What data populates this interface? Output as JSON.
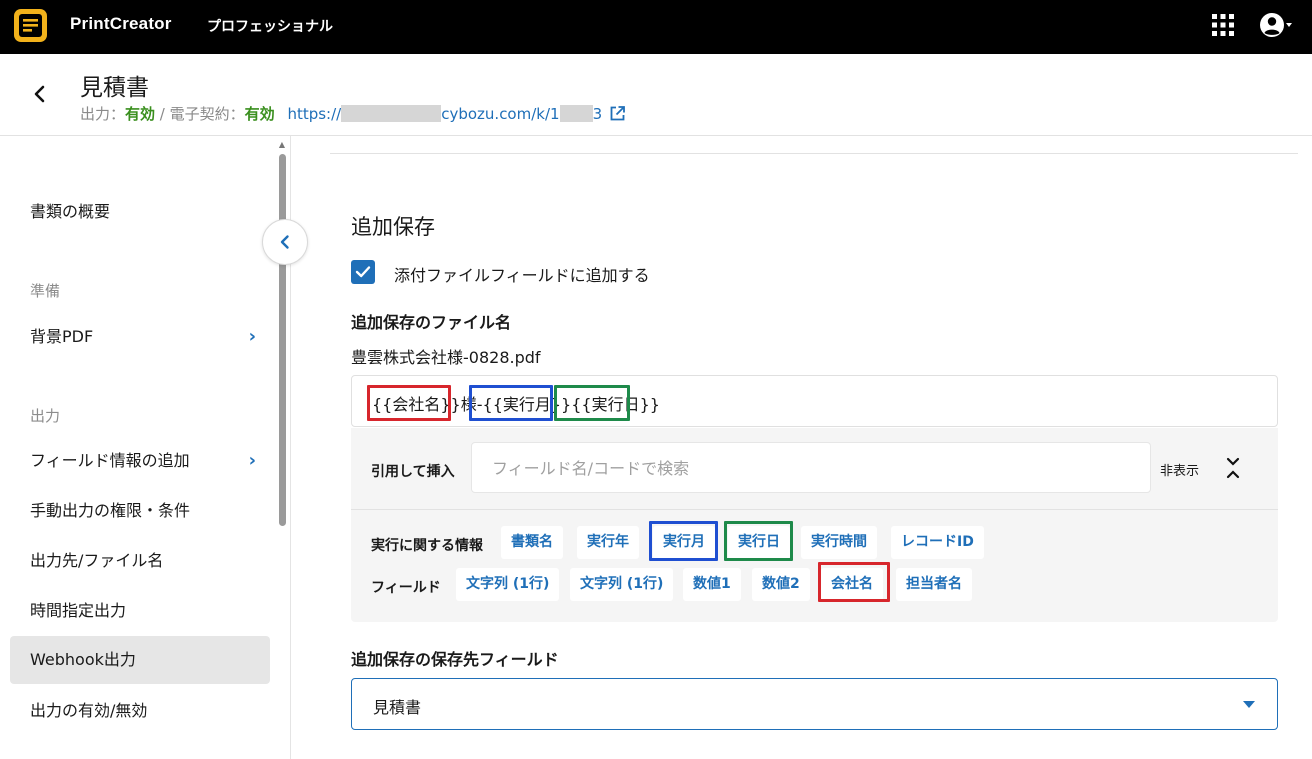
{
  "app": {
    "name": "PrintCreator",
    "edition": "プロフェッショナル",
    "colors": {
      "topbar": "#000000",
      "accent": "#1f6fb8",
      "ok": "#3a8f1e"
    }
  },
  "header": {
    "title": "見積書",
    "output_label": "出力：",
    "output_status": "有効",
    "separator": " / ",
    "contract_label": "電子契約：",
    "contract_status": "有効",
    "url_prefix": "https://",
    "url_middle": "cybozu.com/k/1",
    "url_suffix": "3"
  },
  "sidebar": {
    "overview": "書類の概要",
    "section_prep": "準備",
    "background_pdf": "背景PDF",
    "section_output": "出力",
    "items": [
      {
        "label": "フィールド情報の追加",
        "has_chevron": true
      },
      {
        "label": "手動出力の権限・条件"
      },
      {
        "label": "出力先/ファイル名"
      },
      {
        "label": "時間指定出力"
      },
      {
        "label": "Webhook出力",
        "active": true
      },
      {
        "label": "出力の有効/無効"
      }
    ],
    "chevron": "›"
  },
  "main": {
    "section_title": "追加保存",
    "checkbox_label": "添付ファイルフィールドに追加する",
    "checkbox_checked": true,
    "filename_label": "追加保存のファイル名",
    "filename_preview": "豊雲株式会社様-0828.pdf",
    "template": {
      "part1": "{{会社名}}",
      "part2": "様-",
      "part3": "{{実行月}}",
      "part4": "{{実行日}}"
    },
    "picker": {
      "insert_label": "引用して挿入",
      "search_placeholder": "フィールド名/コードで検索",
      "hide_label": "非表示",
      "exec_row_label": "実行に関する情報",
      "exec_chips": [
        "書類名",
        "実行年",
        "実行月",
        "実行日",
        "実行時間",
        "レコードID"
      ],
      "field_row_label": "フィールド",
      "field_chips": [
        "文字列 (1行)",
        "文字列 (1行)",
        "数値1",
        "数値2",
        "会社名",
        "担当者名"
      ]
    },
    "dest_label": "追加保存の保存先フィールド",
    "dest_value": "見積書"
  },
  "highlights": {
    "red": "#d7262c",
    "blue": "#1f4fd1",
    "green": "#1e8a4a"
  }
}
